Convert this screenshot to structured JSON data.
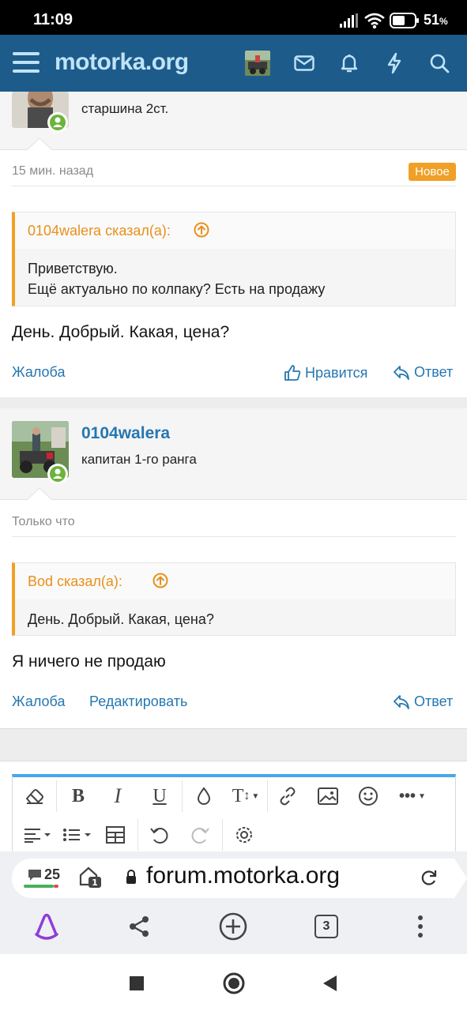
{
  "status_bar": {
    "time": "11:09",
    "battery_percent": "51",
    "battery_suffix": "%"
  },
  "header": {
    "logo": "motorka.org",
    "icons": [
      "menu-icon",
      "user-avatar",
      "envelope-icon",
      "bell-icon",
      "lightning-icon",
      "search-icon"
    ]
  },
  "post1": {
    "user_title": "старшина 2ст.",
    "time": "15 мин. назад",
    "badge": "Новое",
    "quote": {
      "author": "0104walera сказал(а):",
      "lines": [
        "Приветствую.",
        "Ещё актуально по колпаку? Есть на продажу"
      ]
    },
    "message": "День. Добрый. Какая, цена?",
    "actions": {
      "report": "Жалоба",
      "like": "Нравится",
      "reply": "Ответ"
    }
  },
  "post2": {
    "username": "0104walera",
    "user_title": "капитан 1-го ранга",
    "time": "Только что",
    "quote": {
      "author": "Bod сказал(а):",
      "lines": [
        "День. Добрый. Какая, цена?"
      ]
    },
    "message": "Я ничего не продаю",
    "actions": {
      "report": "Жалоба",
      "edit": "Редактировать",
      "reply": "Ответ"
    }
  },
  "browser": {
    "comments_count": "25",
    "url": "forum.motorka.org",
    "tab_count": "3"
  },
  "colors": {
    "header": "#1d5b8b",
    "accent": "#f0a026",
    "link": "#2577b1",
    "online": "#6bb33a"
  }
}
